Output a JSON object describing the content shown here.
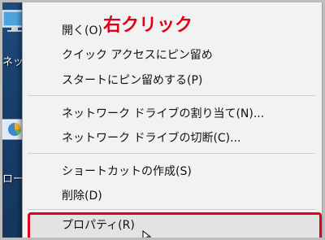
{
  "annotation": {
    "callout": "右クリック",
    "callout_color": "#e3001b"
  },
  "desktop": {
    "icons": [
      {
        "label": "ネット",
        "icon": "network-icon"
      },
      {
        "label": "ローー",
        "icon": "control-panel-icon"
      }
    ]
  },
  "context_menu": {
    "groups": [
      [
        "開く(O)",
        "クイック アクセスにピン留め",
        "スタートにピン留めする(P)"
      ],
      [
        "ネットワーク ドライブの割り当て(N)...",
        "ネットワーク ドライブの切断(C)..."
      ],
      [
        "ショートカットの作成(S)",
        "削除(D)"
      ],
      [
        "プロパティ(R)"
      ]
    ],
    "highlighted_item": "プロパティ(R)"
  }
}
